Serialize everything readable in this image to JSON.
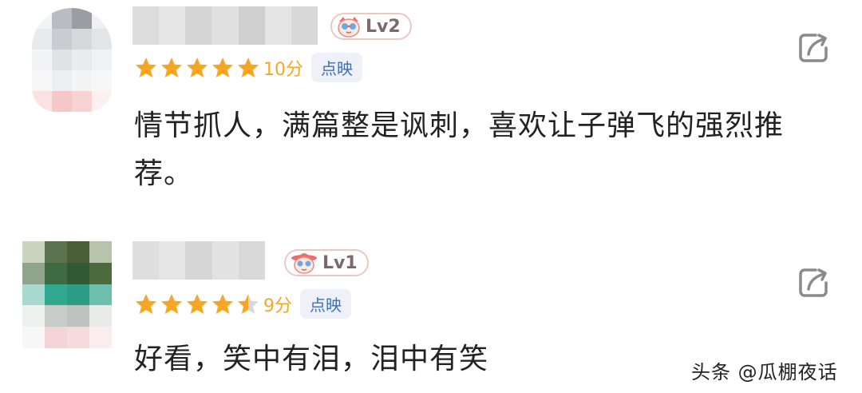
{
  "reviews": [
    {
      "level": "Lv2",
      "rating": 5,
      "score": "10分",
      "source": "点映",
      "text": "情节抓人，满篇整是讽刺，喜欢让子弹飞的强烈推荐。"
    },
    {
      "level": "Lv1",
      "rating": 4.5,
      "score": "9分",
      "source": "点映",
      "text": "好看，笑中有泪，泪中有笑"
    }
  ],
  "watermark": "头条 @瓜棚夜话",
  "colors": {
    "star": "#f5a623",
    "star_empty": "#d8d8d8",
    "tag_text": "#3f6fb5",
    "tag_bg": "#eef1f7"
  },
  "icons": {
    "share": "share-icon",
    "badge": "cat-face-icon"
  }
}
